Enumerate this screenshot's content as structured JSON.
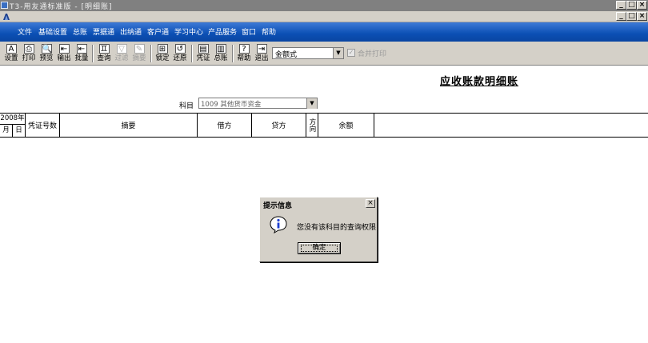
{
  "window": {
    "title": "T3-用友通标准版 - [明细账]",
    "minimize_glyph": "_",
    "maximize_glyph": "□",
    "close_glyph": "×"
  },
  "menu": [
    "文件",
    "基础设置",
    "总账",
    "票据通",
    "出纳通",
    "客户通",
    "学习中心",
    "产品服务",
    "窗口",
    "帮助"
  ],
  "toolbar": {
    "buttons": [
      {
        "label": "设置",
        "icon": "settings-icon",
        "glyph": "A"
      },
      {
        "label": "打印",
        "icon": "printer-icon",
        "glyph": "⎙"
      },
      {
        "label": "预览",
        "icon": "preview-icon",
        "glyph": "🔍"
      },
      {
        "label": "输出",
        "icon": "export-icon",
        "glyph": "⇤"
      },
      {
        "label": "批量",
        "icon": "batch-icon",
        "glyph": "⇤"
      },
      {
        "label": "查询",
        "icon": "binoculars-icon",
        "glyph": "♊"
      },
      {
        "label": "过滤",
        "icon": "filter-icon",
        "glyph": "▽",
        "disabled": true
      },
      {
        "label": "摘要",
        "icon": "summary-icon",
        "glyph": "✎",
        "disabled": true
      },
      {
        "label": "锁定",
        "icon": "lock-icon",
        "glyph": "⊞"
      },
      {
        "label": "还原",
        "icon": "restore-icon",
        "glyph": "↺"
      },
      {
        "label": "凭证",
        "icon": "voucher-icon",
        "glyph": "▤"
      },
      {
        "label": "总账",
        "icon": "ledger-icon",
        "glyph": "▥"
      },
      {
        "label": "帮助",
        "icon": "help-icon",
        "glyph": "?"
      },
      {
        "label": "退出",
        "icon": "exit-icon",
        "glyph": "⇥"
      }
    ],
    "format_select": "金额式",
    "merge_print_label": "合并打印",
    "merge_print_checked": true
  },
  "report": {
    "title": "应收账款明细账",
    "subject_label": "科目",
    "subject_value": "1009 其他货币资金"
  },
  "table": {
    "year": "2008年",
    "month": "月",
    "day": "日",
    "columns": [
      "凭证号数",
      "摘要",
      "借方",
      "贷方",
      "方向",
      "余额"
    ]
  },
  "dialog": {
    "title": "提示信息",
    "message": "您没有该科目的查询权限",
    "ok_label": "确定",
    "icon": "info-icon"
  }
}
